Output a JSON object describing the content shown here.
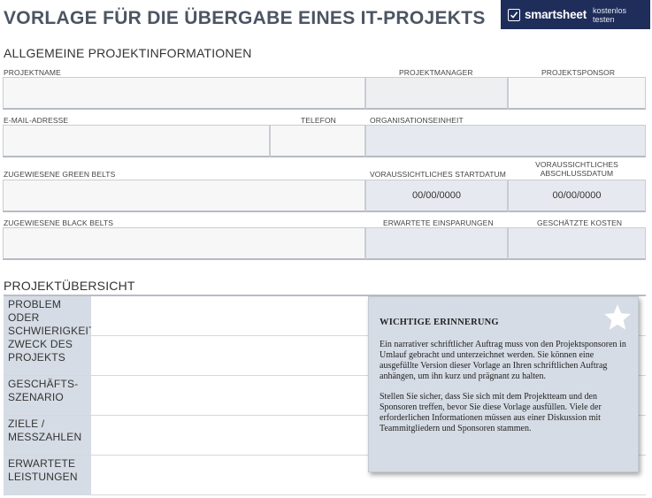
{
  "title": "VORLAGE FÜR DIE ÜBERGABE EINES IT-PROJEKTS",
  "brand": {
    "name": "smartsheet",
    "cta": "kostenlos testen"
  },
  "sections": {
    "general": "ALLGEMEINE PROJEKTINFORMATIONEN",
    "overview": "PROJEKTÜBERSICHT"
  },
  "labels": {
    "project_name": "PROJEKTNAME",
    "project_manager": "PROJEKTMANAGER",
    "project_sponsor": "PROJEKTSPONSOR",
    "email": "E-MAIL-ADRESSE",
    "phone": "TELEFON",
    "org_unit": "ORGANISATIONSEINHEIT",
    "green_belts": "ZUGEWIESENE GREEN BELTS",
    "start_date": "VORAUSSICHTLICHES STARTDATUM",
    "end_date": "VORAUSSICHTLICHES ABSCHLUSSDATUM",
    "black_belts": "ZUGEWIESENE BLACK BELTS",
    "savings": "ERWARTETE EINSPARUNGEN",
    "costs": "GESCHÄTZTE KOSTEN"
  },
  "values": {
    "start_date": "00/00/0000",
    "end_date": "00/00/0000"
  },
  "overview_rows": [
    "PROBLEM ODER SCHWIERIGKEIT",
    "ZWECK DES PROJEKTS",
    "GESCHÄFTS-SZENARIO",
    "ZIELE / MESSZAHLEN",
    "ERWARTETE LEISTUNGEN"
  ],
  "note": {
    "title": "WICHTIGE ERINNERUNG",
    "p1": "Ein narrativer schriftlicher Auftrag muss von den Projektsponsoren in Umlauf gebracht und unterzeichnet werden. Sie können eine ausgefüllte Version dieser Vorlage an Ihren schriftlichen Auftrag anhängen, um ihn kurz und prägnant zu halten.",
    "p2": "Stellen Sie sicher, dass Sie sich mit dem Projektteam und den Sponsoren treffen, bevor Sie diese Vorlage ausfüllen. Viele der erforderlichen Informationen müssen aus einer Diskussion mit Teammitgliedern und Sponsoren stammen."
  },
  "icons": {
    "brand": "checkmark-icon",
    "note": "star-icon"
  },
  "colors": {
    "brand_bg": "#1f2d5a",
    "label_bg": "#d6dce5",
    "title": "#4b5563"
  }
}
